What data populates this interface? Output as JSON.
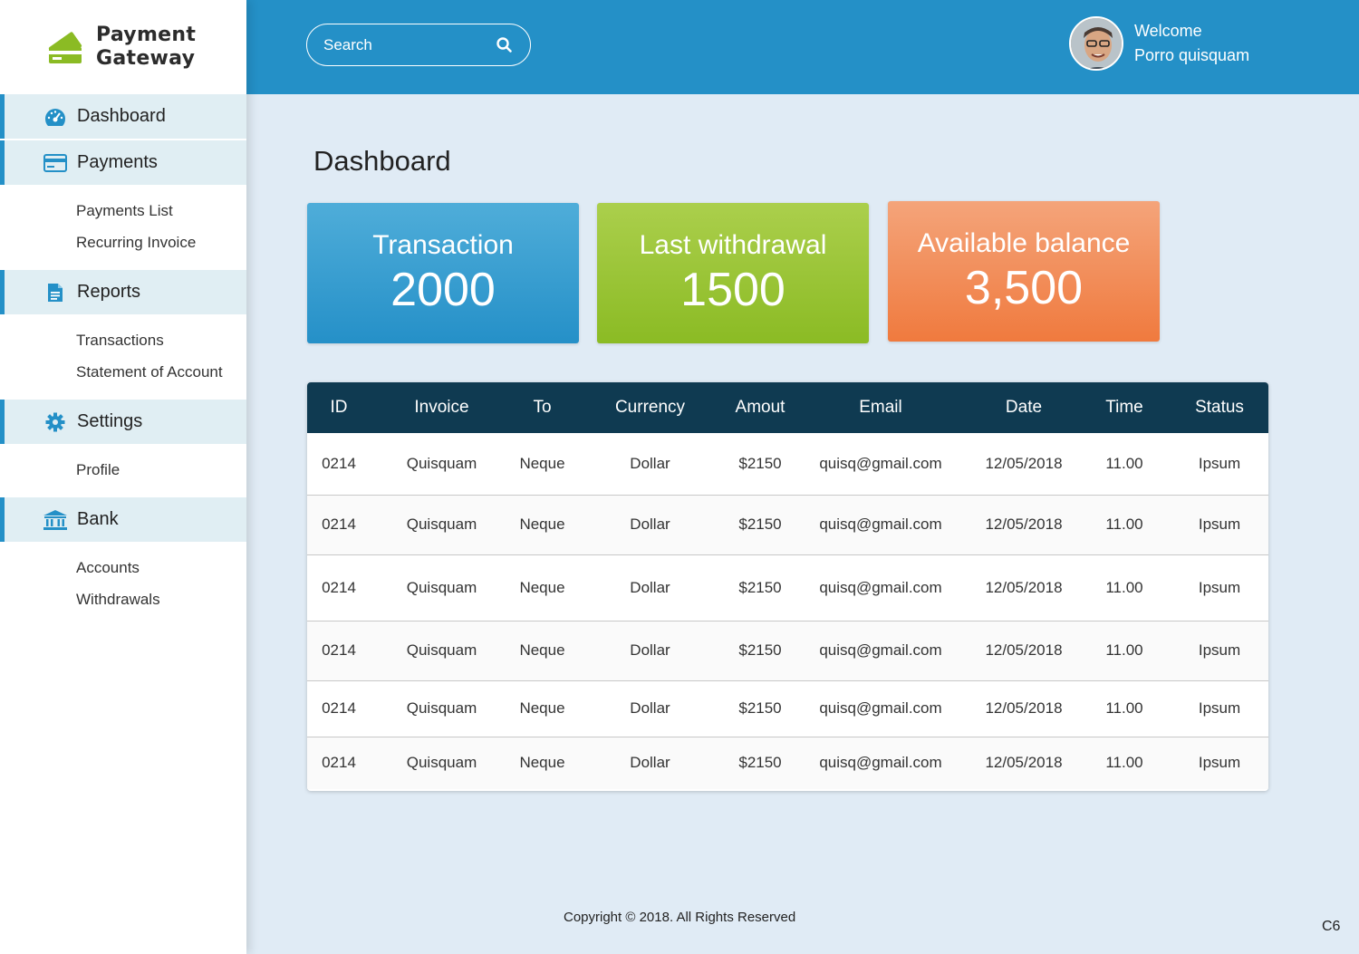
{
  "brand": {
    "line1": "Payment",
    "line2": "Gateway"
  },
  "sidebar": {
    "groups": [
      {
        "label": "Dashboard",
        "icon": "dashboard-gauge-icon",
        "items": []
      },
      {
        "label": "Payments",
        "icon": "credit-card-icon",
        "items": [
          "Payments List",
          "Recurring Invoice"
        ]
      },
      {
        "label": "Reports",
        "icon": "document-icon",
        "items": [
          "Transactions",
          "Statement of Account"
        ]
      },
      {
        "label": "Settings",
        "icon": "gear-icon",
        "items": [
          "Profile"
        ]
      },
      {
        "label": "Bank",
        "icon": "bank-icon",
        "items": [
          "Accounts",
          "Withdrawals"
        ]
      }
    ]
  },
  "header": {
    "search_placeholder": "Search",
    "welcome": "Welcome",
    "user_name": "Porro quisquam"
  },
  "page": {
    "title": "Dashboard"
  },
  "cards": [
    {
      "label": "Transaction",
      "value": "2000",
      "color": "#2590c8"
    },
    {
      "label": "Last withdrawal",
      "value": "1500",
      "color": "#8bbb24"
    },
    {
      "label": "Available balance",
      "value": "3,500",
      "color": "#f07a3e"
    }
  ],
  "table": {
    "columns": [
      "ID",
      "Invoice",
      "To",
      "Currency",
      "Amout",
      "Email",
      "Date",
      "Time",
      "Status"
    ],
    "rows": [
      [
        "0214",
        "Quisquam",
        "Neque",
        "Dollar",
        "$2150",
        "quisq@gmail.com",
        "12/05/2018",
        "11.00",
        "Ipsum"
      ],
      [
        "0214",
        "Quisquam",
        "Neque",
        "Dollar",
        "$2150",
        "quisq@gmail.com",
        "12/05/2018",
        "11.00",
        "Ipsum"
      ],
      [
        "0214",
        "Quisquam",
        "Neque",
        "Dollar",
        "$2150",
        "quisq@gmail.com",
        "12/05/2018",
        "11.00",
        "Ipsum"
      ],
      [
        "0214",
        "Quisquam",
        "Neque",
        "Dollar",
        "$2150",
        "quisq@gmail.com",
        "12/05/2018",
        "11.00",
        "Ipsum"
      ],
      [
        "0214",
        "Quisquam",
        "Neque",
        "Dollar",
        "$2150",
        "quisq@gmail.com",
        "12/05/2018",
        "11.00",
        "Ipsum"
      ],
      [
        "0214",
        "Quisquam",
        "Neque",
        "Dollar",
        "$2150",
        "quisq@gmail.com",
        "12/05/2018",
        "11.00",
        "Ipsum"
      ]
    ]
  },
  "footer": {
    "copyright": "Copyright © 2018. All Rights Reserved",
    "corner": "C6"
  },
  "colors": {
    "header": "#2490c7",
    "table_header": "#0f3a51",
    "brand_green": "#8bbb24",
    "background": "#e0ebf5"
  }
}
